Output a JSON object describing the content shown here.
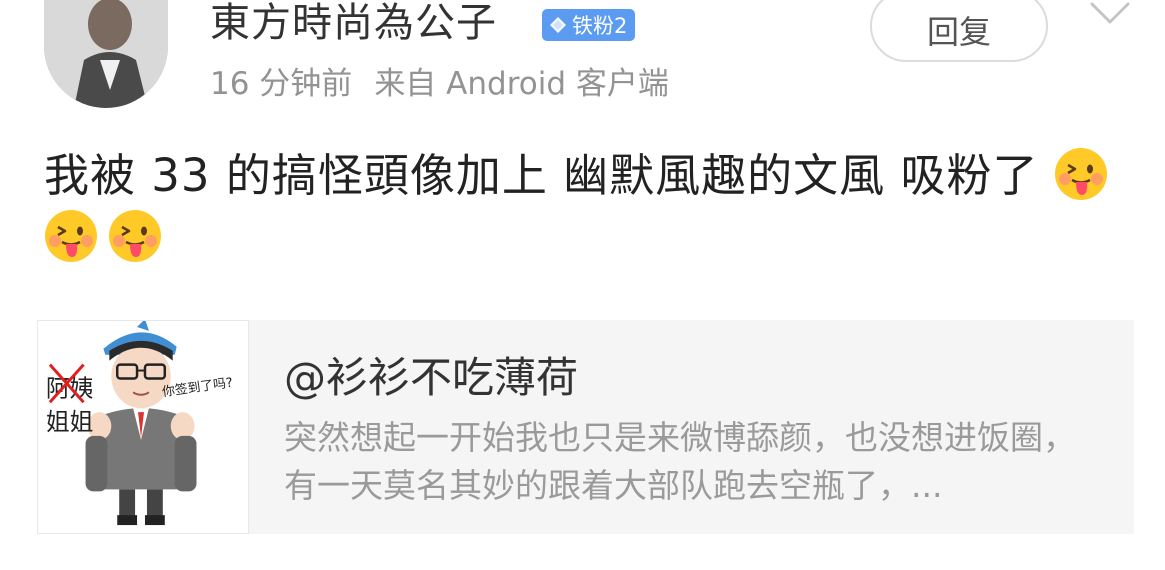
{
  "post": {
    "author": "東方時尚為公子",
    "badge": "铁粉2",
    "time": "16 分钟前",
    "source": "来自 Android 客户端",
    "reply_label": "回复",
    "text": "我被 33 的搞怪頭像加上 幽默風趣的文風 吸粉了",
    "emojis": [
      "tongue-emoji",
      "tongue-emoji",
      "tongue-emoji"
    ]
  },
  "quote": {
    "title": "@衫衫不吃薄荷",
    "body": "突然想起一开始我也只是来微博舔颜，也没想进饭圈，有一天莫名其妙的跟着大部队跑去空瓶了，...",
    "image_text": {
      "crossed": "阿姨",
      "replacement": "姐姐",
      "bubble": "你签到了吗?"
    }
  },
  "colors": {
    "badge": "#5b9cf2",
    "meta": "#939393",
    "quote_bg": "#f5f5f5",
    "cross": "#e02020"
  }
}
